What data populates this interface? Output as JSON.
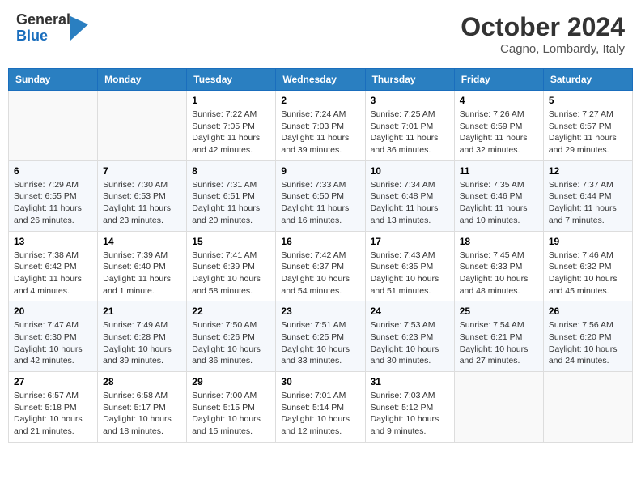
{
  "header": {
    "logo": {
      "general": "General",
      "blue": "Blue"
    },
    "title": "October 2024",
    "location": "Cagno, Lombardy, Italy"
  },
  "days_of_week": [
    "Sunday",
    "Monday",
    "Tuesday",
    "Wednesday",
    "Thursday",
    "Friday",
    "Saturday"
  ],
  "weeks": [
    [
      {
        "day": "",
        "info": ""
      },
      {
        "day": "",
        "info": ""
      },
      {
        "day": "1",
        "info": "Sunrise: 7:22 AM\nSunset: 7:05 PM\nDaylight: 11 hours and 42 minutes."
      },
      {
        "day": "2",
        "info": "Sunrise: 7:24 AM\nSunset: 7:03 PM\nDaylight: 11 hours and 39 minutes."
      },
      {
        "day": "3",
        "info": "Sunrise: 7:25 AM\nSunset: 7:01 PM\nDaylight: 11 hours and 36 minutes."
      },
      {
        "day": "4",
        "info": "Sunrise: 7:26 AM\nSunset: 6:59 PM\nDaylight: 11 hours and 32 minutes."
      },
      {
        "day": "5",
        "info": "Sunrise: 7:27 AM\nSunset: 6:57 PM\nDaylight: 11 hours and 29 minutes."
      }
    ],
    [
      {
        "day": "6",
        "info": "Sunrise: 7:29 AM\nSunset: 6:55 PM\nDaylight: 11 hours and 26 minutes."
      },
      {
        "day": "7",
        "info": "Sunrise: 7:30 AM\nSunset: 6:53 PM\nDaylight: 11 hours and 23 minutes."
      },
      {
        "day": "8",
        "info": "Sunrise: 7:31 AM\nSunset: 6:51 PM\nDaylight: 11 hours and 20 minutes."
      },
      {
        "day": "9",
        "info": "Sunrise: 7:33 AM\nSunset: 6:50 PM\nDaylight: 11 hours and 16 minutes."
      },
      {
        "day": "10",
        "info": "Sunrise: 7:34 AM\nSunset: 6:48 PM\nDaylight: 11 hours and 13 minutes."
      },
      {
        "day": "11",
        "info": "Sunrise: 7:35 AM\nSunset: 6:46 PM\nDaylight: 11 hours and 10 minutes."
      },
      {
        "day": "12",
        "info": "Sunrise: 7:37 AM\nSunset: 6:44 PM\nDaylight: 11 hours and 7 minutes."
      }
    ],
    [
      {
        "day": "13",
        "info": "Sunrise: 7:38 AM\nSunset: 6:42 PM\nDaylight: 11 hours and 4 minutes."
      },
      {
        "day": "14",
        "info": "Sunrise: 7:39 AM\nSunset: 6:40 PM\nDaylight: 11 hours and 1 minute."
      },
      {
        "day": "15",
        "info": "Sunrise: 7:41 AM\nSunset: 6:39 PM\nDaylight: 10 hours and 58 minutes."
      },
      {
        "day": "16",
        "info": "Sunrise: 7:42 AM\nSunset: 6:37 PM\nDaylight: 10 hours and 54 minutes."
      },
      {
        "day": "17",
        "info": "Sunrise: 7:43 AM\nSunset: 6:35 PM\nDaylight: 10 hours and 51 minutes."
      },
      {
        "day": "18",
        "info": "Sunrise: 7:45 AM\nSunset: 6:33 PM\nDaylight: 10 hours and 48 minutes."
      },
      {
        "day": "19",
        "info": "Sunrise: 7:46 AM\nSunset: 6:32 PM\nDaylight: 10 hours and 45 minutes."
      }
    ],
    [
      {
        "day": "20",
        "info": "Sunrise: 7:47 AM\nSunset: 6:30 PM\nDaylight: 10 hours and 42 minutes."
      },
      {
        "day": "21",
        "info": "Sunrise: 7:49 AM\nSunset: 6:28 PM\nDaylight: 10 hours and 39 minutes."
      },
      {
        "day": "22",
        "info": "Sunrise: 7:50 AM\nSunset: 6:26 PM\nDaylight: 10 hours and 36 minutes."
      },
      {
        "day": "23",
        "info": "Sunrise: 7:51 AM\nSunset: 6:25 PM\nDaylight: 10 hours and 33 minutes."
      },
      {
        "day": "24",
        "info": "Sunrise: 7:53 AM\nSunset: 6:23 PM\nDaylight: 10 hours and 30 minutes."
      },
      {
        "day": "25",
        "info": "Sunrise: 7:54 AM\nSunset: 6:21 PM\nDaylight: 10 hours and 27 minutes."
      },
      {
        "day": "26",
        "info": "Sunrise: 7:56 AM\nSunset: 6:20 PM\nDaylight: 10 hours and 24 minutes."
      }
    ],
    [
      {
        "day": "27",
        "info": "Sunrise: 6:57 AM\nSunset: 5:18 PM\nDaylight: 10 hours and 21 minutes."
      },
      {
        "day": "28",
        "info": "Sunrise: 6:58 AM\nSunset: 5:17 PM\nDaylight: 10 hours and 18 minutes."
      },
      {
        "day": "29",
        "info": "Sunrise: 7:00 AM\nSunset: 5:15 PM\nDaylight: 10 hours and 15 minutes."
      },
      {
        "day": "30",
        "info": "Sunrise: 7:01 AM\nSunset: 5:14 PM\nDaylight: 10 hours and 12 minutes."
      },
      {
        "day": "31",
        "info": "Sunrise: 7:03 AM\nSunset: 5:12 PM\nDaylight: 10 hours and 9 minutes."
      },
      {
        "day": "",
        "info": ""
      },
      {
        "day": "",
        "info": ""
      }
    ]
  ]
}
